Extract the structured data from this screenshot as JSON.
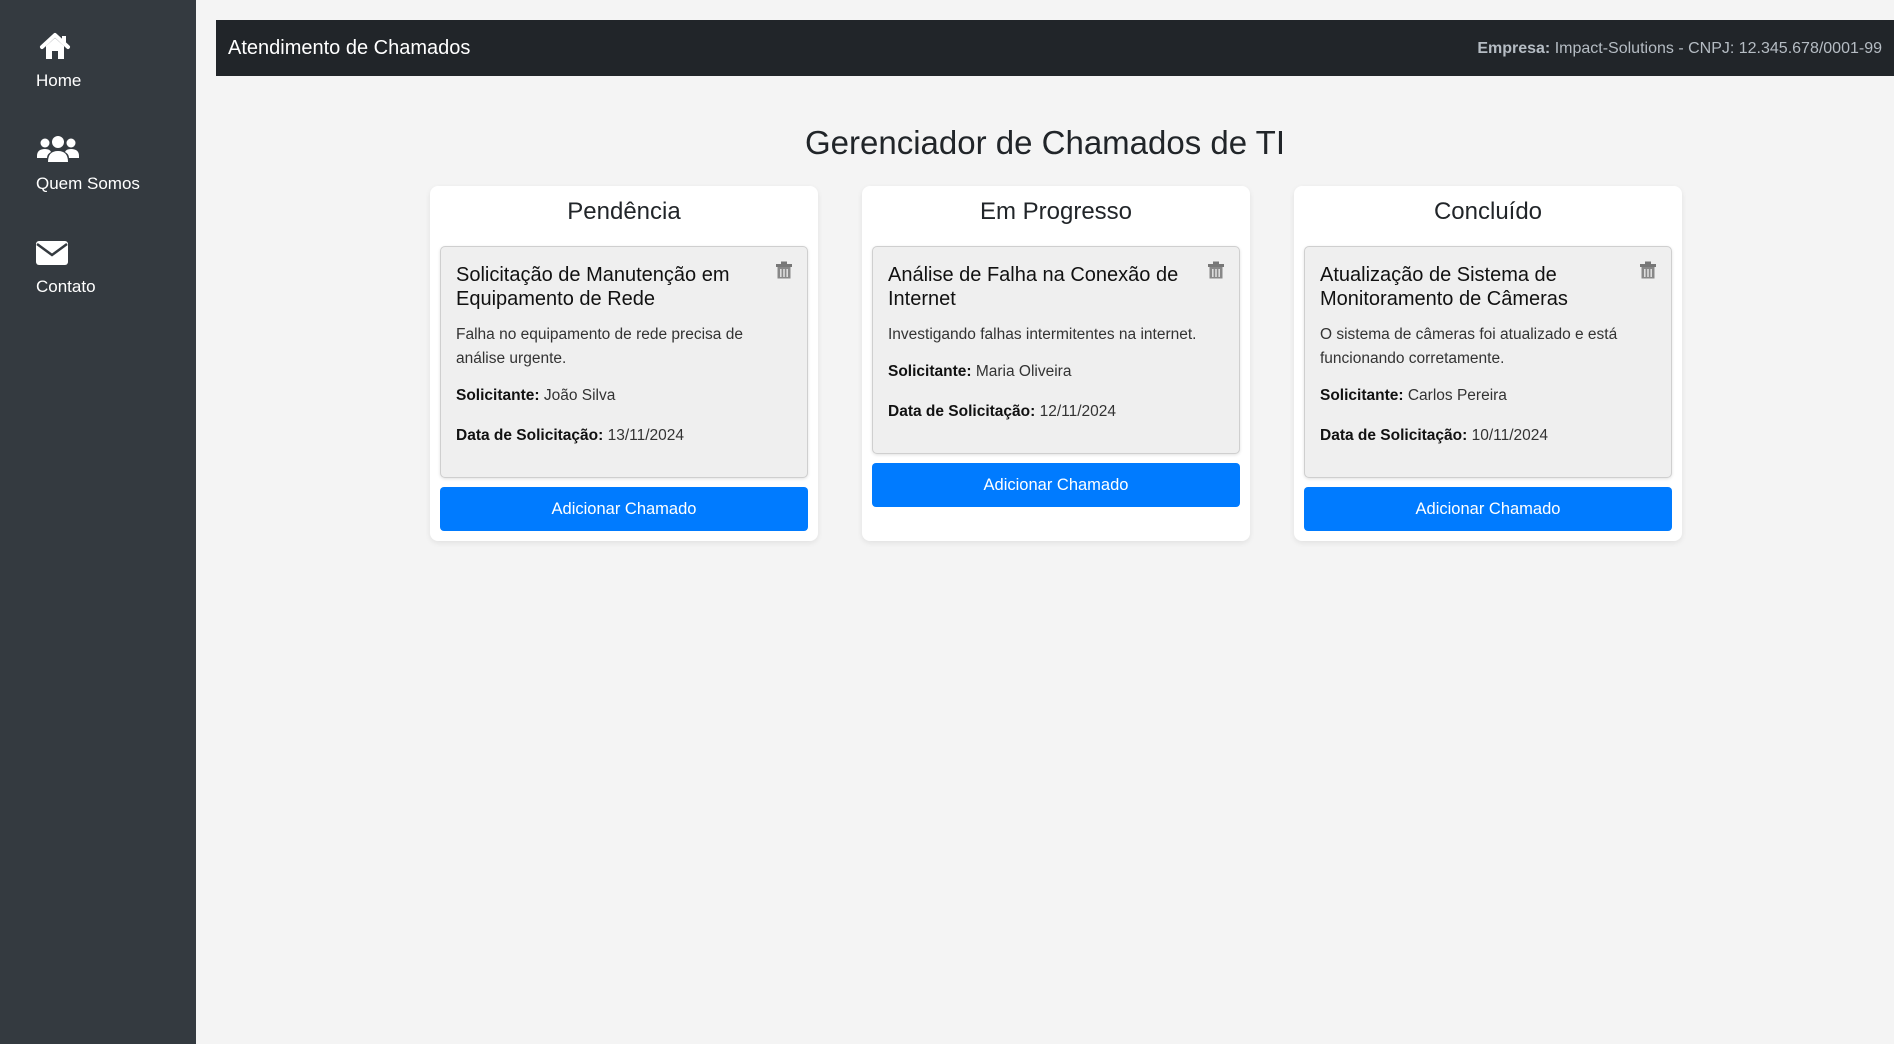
{
  "sidebar": {
    "items": [
      {
        "label": "Home",
        "icon": "home-icon"
      },
      {
        "label": "Quem Somos",
        "icon": "users-icon"
      },
      {
        "label": "Contato",
        "icon": "envelope-icon"
      }
    ]
  },
  "header": {
    "title": "Atendimento de Chamados",
    "company_label": "Empresa:",
    "company_value": "Impact-Solutions - CNPJ: 12.345.678/0001-99"
  },
  "main": {
    "title": "Gerenciador de Chamados de TI",
    "columns": [
      {
        "title": "Pendência",
        "button_label": "Adicionar Chamado",
        "tickets": [
          {
            "title": "Solicitação de Manutenção em Equipamento de Rede",
            "description": "Falha no equipamento de rede precisa de análise urgente.",
            "requester_label": "Solicitante:",
            "requester": "João Silva",
            "date_label": "Data de Solicitação:",
            "date": "13/11/2024"
          }
        ]
      },
      {
        "title": "Em Progresso",
        "button_label": "Adicionar Chamado",
        "tickets": [
          {
            "title": "Análise de Falha na Conexão de Internet",
            "description": "Investigando falhas intermitentes na internet.",
            "requester_label": "Solicitante:",
            "requester": "Maria Oliveira",
            "date_label": "Data de Solicitação:",
            "date": "12/11/2024"
          }
        ]
      },
      {
        "title": "Concluído",
        "button_label": "Adicionar Chamado",
        "tickets": [
          {
            "title": "Atualização de Sistema de Monitoramento de Câmeras",
            "description": "O sistema de câmeras foi atualizado e está funcionando corretamente.",
            "requester_label": "Solicitante:",
            "requester": "Carlos Pereira",
            "date_label": "Data de Solicitação:",
            "date": "10/11/2024"
          }
        ]
      }
    ]
  },
  "colors": {
    "sidebar_bg": "#343a40",
    "topbar_bg": "#212529",
    "page_bg": "#f4f4f4",
    "primary_button": "#007bff",
    "card_bg": "#efefef"
  }
}
